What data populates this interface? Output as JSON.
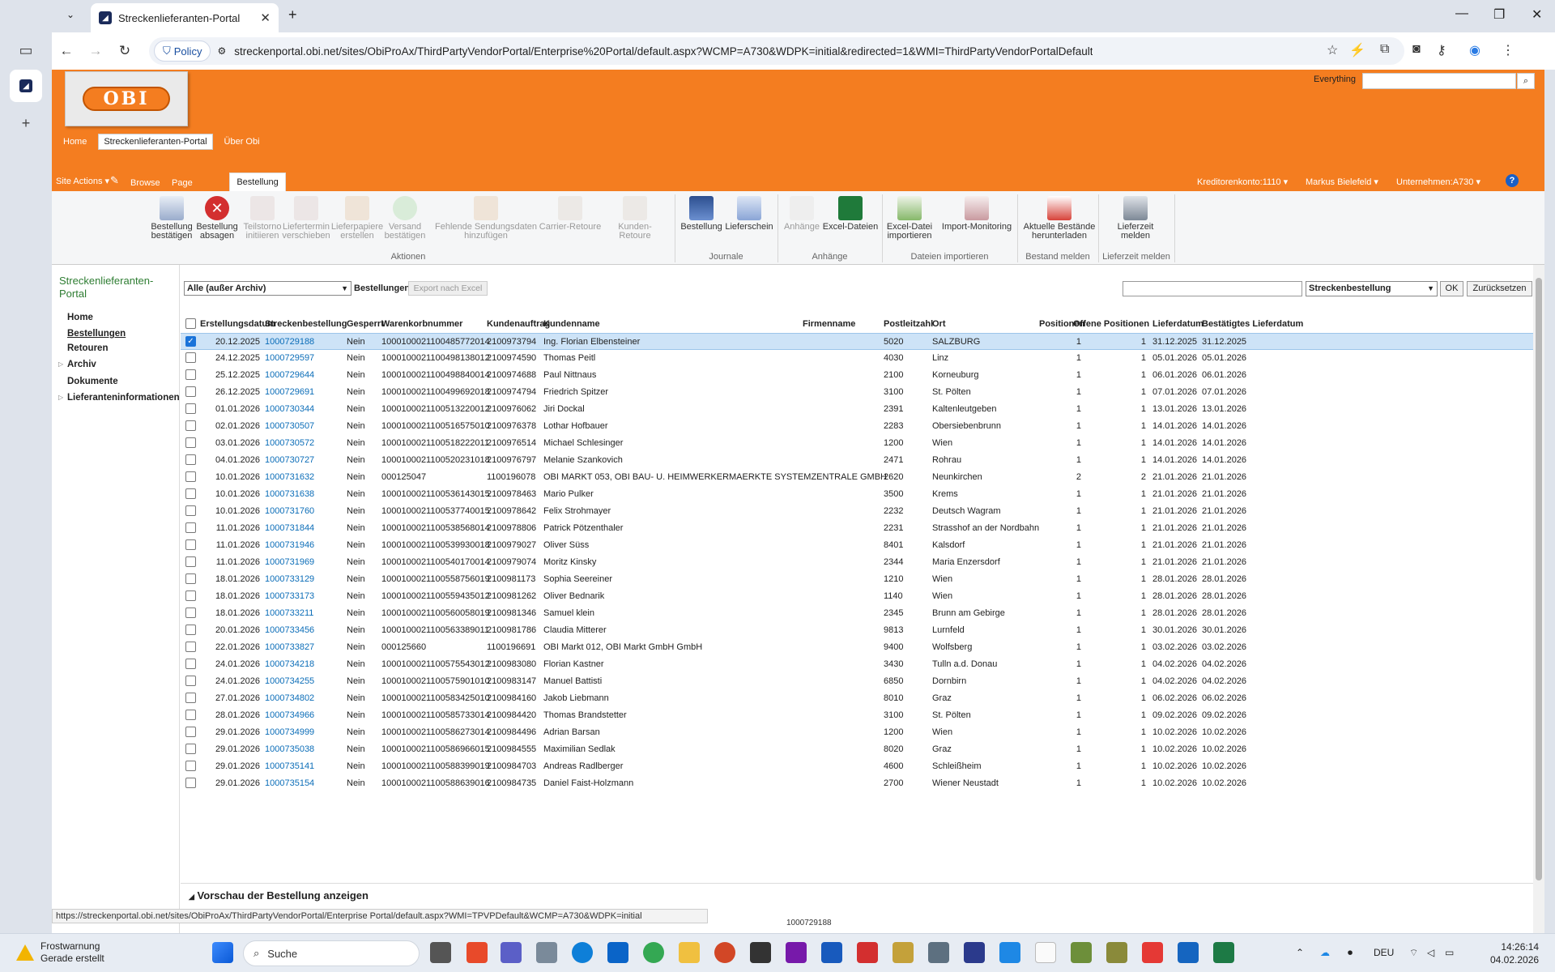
{
  "browser": {
    "tab_title": "Streckenlieferanten-Portal",
    "policy_label": "Policy",
    "url": "streckenportal.obi.net/sites/ObiProAx/ThirdPartyVendorPortal/Enterprise%20Portal/default.aspx?WCMP=A730&WDPK=initial&redirected=1&WMI=ThirdPartyVendorPortalDefault"
  },
  "header": {
    "logo_text": "OBI",
    "search_scope": "Everything",
    "topnav": [
      "Home",
      "Streckenlieferanten-Portal",
      "Über Obi"
    ],
    "topnav_active": "Streckenlieferanten-Portal",
    "site_actions": "Site Actions",
    "ribbon_tabs": [
      "Browse",
      "Page"
    ],
    "ribbon_tab_active": "Bestellung",
    "kreditorenkonto": "Kreditorenkonto:1110",
    "user": "Markus Bielefeld",
    "unternehmen": "Unternehmen:A730"
  },
  "ribbon": {
    "buttons": [
      {
        "label1": "Bestellung",
        "label2": "bestätigen"
      },
      {
        "label1": "Bestellung",
        "label2": "absagen"
      },
      {
        "label1": "Teilstorno",
        "label2": "initiieren"
      },
      {
        "label1": "Liefertermin",
        "label2": "verschieben"
      },
      {
        "label1": "Lieferpapiere",
        "label2": "erstellen"
      },
      {
        "label1": "Versand",
        "label2": "bestätigen"
      },
      {
        "label1": "Fehlende Sendungsdaten",
        "label2": "hinzufügen"
      },
      {
        "label1": "Carrier-Retoure",
        "label2": ""
      },
      {
        "label1": "Kunden-Retoure",
        "label2": ""
      },
      {
        "label1": "Bestellung",
        "label2": ""
      },
      {
        "label1": "Lieferschein",
        "label2": ""
      },
      {
        "label1": "Anhänge",
        "label2": ""
      },
      {
        "label1": "Excel-Dateien",
        "label2": ""
      },
      {
        "label1": "Excel-Datei",
        "label2": "importieren"
      },
      {
        "label1": "Import-Monitoring",
        "label2": ""
      },
      {
        "label1": "Aktuelle Bestände",
        "label2": "herunterladen"
      },
      {
        "label1": "Lieferzeit",
        "label2": "melden"
      }
    ],
    "groups": [
      "Aktionen",
      "Journale",
      "Anhänge",
      "Dateien importieren",
      "Bestand melden",
      "Lieferzeit melden"
    ]
  },
  "leftnav": {
    "title": "Streckenlieferanten-Portal",
    "items": [
      "Home",
      "Bestellungen",
      "Retouren",
      "Archiv",
      "Dokumente",
      "Lieferanteninformationen"
    ]
  },
  "filter": {
    "view": "Alle (außer Archiv)",
    "label": "Bestellungen",
    "export": "Export nach Excel",
    "search_field": "Streckenbestellung",
    "ok": "OK",
    "reset": "Zurücksetzen"
  },
  "table": {
    "columns": [
      "Erstellungsdatum",
      "Streckenbestellung",
      "Gesperrt",
      "Warenkorbnummer",
      "Kundenauftrag",
      "Kundenname",
      "Firmenname",
      "Postleitzahl",
      "Ort",
      "Positionen",
      "Offene Positionen",
      "Lieferdatum",
      "Bestätigtes Lieferdatum"
    ],
    "rows": [
      [
        "20.12.2025",
        "1000729188",
        "Nein",
        "10001000211004857720​14",
        "2100973794",
        "Ing. Florian Elbensteiner",
        "",
        "5020",
        "SALZBURG",
        "1",
        "1",
        "31.12.2025",
        "31.12.2025"
      ],
      [
        "24.12.2025",
        "1000729597",
        "Nein",
        "1000100021100498138012",
        "2100974590",
        "Thomas Peitl",
        "",
        "4030",
        "Linz",
        "1",
        "1",
        "05.01.2026",
        "05.01.2026"
      ],
      [
        "25.12.2025",
        "1000729644",
        "Nein",
        "1000100021100498840014",
        "2100974688",
        "Paul Nittnaus",
        "",
        "2100",
        "Korneuburg",
        "1",
        "1",
        "06.01.2026",
        "06.01.2026"
      ],
      [
        "26.12.2025",
        "1000729691",
        "Nein",
        "1000100021100499692018",
        "2100974794",
        "Friedrich Spitzer",
        "",
        "3100",
        "St. Pölten",
        "1",
        "1",
        "07.01.2026",
        "07.01.2026"
      ],
      [
        "01.01.2026",
        "1000730344",
        "Nein",
        "1000100021100513220012",
        "2100976062",
        "Jiri Dockal",
        "",
        "2391",
        "Kaltenleutgeben",
        "1",
        "1",
        "13.01.2026",
        "13.01.2026"
      ],
      [
        "02.01.2026",
        "1000730507",
        "Nein",
        "1000100021100516575010",
        "2100976378",
        "Lothar Hofbauer",
        "",
        "2283",
        "Obersiebenbrunn",
        "1",
        "1",
        "14.01.2026",
        "14.01.2026"
      ],
      [
        "03.01.2026",
        "1000730572",
        "Nein",
        "1000100021100518222011",
        "2100976514",
        "Michael Schlesinger",
        "",
        "1200",
        "Wien",
        "1",
        "1",
        "14.01.2026",
        "14.01.2026"
      ],
      [
        "04.01.2026",
        "1000730727",
        "Nein",
        "1000100021100520231018",
        "2100976797",
        "Melanie Szankovich",
        "",
        "2471",
        "Rohrau",
        "1",
        "1",
        "14.01.2026",
        "14.01.2026"
      ],
      [
        "10.01.2026",
        "1000731632",
        "Nein",
        "000125047",
        "1100196078",
        "OBI MARKT 053, OBI BAU- U. HEIMWERKERMAERKTE SYSTEMZENTRALE GMBH",
        "",
        "2620",
        "Neunkirchen",
        "2",
        "2",
        "21.01.2026",
        "21.01.2026"
      ],
      [
        "10.01.2026",
        "1000731638",
        "Nein",
        "1000100021100536143015",
        "2100978463",
        "Mario Pulker",
        "",
        "3500",
        "Krems",
        "1",
        "1",
        "21.01.2026",
        "21.01.2026"
      ],
      [
        "10.01.2026",
        "1000731760",
        "Nein",
        "1000100021100537740015",
        "2100978642",
        "Felix Strohmayer",
        "",
        "2232",
        "Deutsch Wagram",
        "1",
        "1",
        "21.01.2026",
        "21.01.2026"
      ],
      [
        "11.01.2026",
        "1000731844",
        "Nein",
        "1000100021100538568014",
        "2100978806",
        "Patrick Pötzenthaler",
        "",
        "2231",
        "Strasshof an der Nordbahn",
        "1",
        "1",
        "21.01.2026",
        "21.01.2026"
      ],
      [
        "11.01.2026",
        "1000731946",
        "Nein",
        "1000100021100539930018",
        "2100979027",
        "Oliver Süss",
        "",
        "8401",
        "Kalsdorf",
        "1",
        "1",
        "21.01.2026",
        "21.01.2026"
      ],
      [
        "11.01.2026",
        "1000731969",
        "Nein",
        "1000100021100540170014",
        "2100979074",
        "Moritz Kinsky",
        "",
        "2344",
        "Maria Enzersdorf",
        "1",
        "1",
        "21.01.2026",
        "21.01.2026"
      ],
      [
        "18.01.2026",
        "1000733129",
        "Nein",
        "1000100021100558756019",
        "2100981173",
        "Sophia Seereiner",
        "",
        "1210",
        "Wien",
        "1",
        "1",
        "28.01.2026",
        "28.01.2026"
      ],
      [
        "18.01.2026",
        "1000733173",
        "Nein",
        "1000100021100559435012",
        "2100981262",
        "Oliver Bednarik",
        "",
        "1140",
        "Wien",
        "1",
        "1",
        "28.01.2026",
        "28.01.2026"
      ],
      [
        "18.01.2026",
        "1000733211",
        "Nein",
        "1000100021100560058019",
        "2100981346",
        "Samuel klein",
        "",
        "2345",
        "Brunn am Gebirge",
        "1",
        "1",
        "28.01.2026",
        "28.01.2026"
      ],
      [
        "20.01.2026",
        "1000733456",
        "Nein",
        "1000100021100563389011",
        "2100981786",
        "Claudia Mitterer",
        "",
        "9813",
        "Lurnfeld",
        "1",
        "1",
        "30.01.2026",
        "30.01.2026"
      ],
      [
        "22.01.2026",
        "1000733827",
        "Nein",
        "000125660",
        "1100196691",
        "OBI Markt 012, OBI Markt GmbH GmbH",
        "",
        "9400",
        "Wolfsberg",
        "1",
        "1",
        "03.02.2026",
        "03.02.2026"
      ],
      [
        "24.01.2026",
        "1000734218",
        "Nein",
        "1000100021100575543012",
        "2100983080",
        "Florian Kastner",
        "",
        "3430",
        "Tulln a.d. Donau",
        "1",
        "1",
        "04.02.2026",
        "04.02.2026"
      ],
      [
        "24.01.2026",
        "1000734255",
        "Nein",
        "1000100021100575901010",
        "2100983147",
        "Manuel Battisti",
        "",
        "6850",
        "Dornbirn",
        "1",
        "1",
        "04.02.2026",
        "04.02.2026"
      ],
      [
        "27.01.2026",
        "1000734802",
        "Nein",
        "1000100021100583425010",
        "2100984160",
        "Jakob Liebmann",
        "",
        "8010",
        "Graz",
        "1",
        "1",
        "06.02.2026",
        "06.02.2026"
      ],
      [
        "28.01.2026",
        "1000734966",
        "Nein",
        "1000100021100585733014",
        "2100984420",
        "Thomas Brandstetter",
        "",
        "3100",
        "St. Pölten",
        "1",
        "1",
        "09.02.2026",
        "09.02.2026"
      ],
      [
        "29.01.2026",
        "1000734999",
        "Nein",
        "1000100021100586273014",
        "2100984496",
        "Adrian Barsan",
        "",
        "1200",
        "Wien",
        "1",
        "1",
        "10.02.2026",
        "10.02.2026"
      ],
      [
        "29.01.2026",
        "1000735038",
        "Nein",
        "1000100021100586966015",
        "2100984555",
        "Maximilian Sedlak",
        "",
        "8020",
        "Graz",
        "1",
        "1",
        "10.02.2026",
        "10.02.2026"
      ],
      [
        "29.01.2026",
        "1000735141",
        "Nein",
        "1000100021100588399019",
        "2100984703",
        "Andreas Radlberger",
        "",
        "4600",
        "Schleißheim",
        "1",
        "1",
        "10.02.2026",
        "10.02.2026"
      ],
      [
        "29.01.2026",
        "1000735154",
        "Nein",
        "1000100021100588639016",
        "2100984735",
        "Daniel Faist-Holzmann",
        "",
        "2700",
        "Wiener Neustadt",
        "1",
        "1",
        "10.02.2026",
        "10.02.2026"
      ]
    ]
  },
  "preview": {
    "title": "Vorschau der Bestellung anzeigen",
    "number": "1000729188",
    "bottom_number": "1000729188"
  },
  "status_url": "https://streckenportal.obi.net/sites/ObiProAx/ThirdPartyVendorPortal/Enterprise Portal/default.aspx?WMI=TPVPDefault&WCMP=A730&WDPK=initial",
  "taskbar": {
    "notify_title": "Frostwarnung",
    "notify_sub": "Gerade erstellt",
    "search": "Suche",
    "lang": "DEU",
    "time": "14:26:14",
    "date": "04.02.2026"
  }
}
